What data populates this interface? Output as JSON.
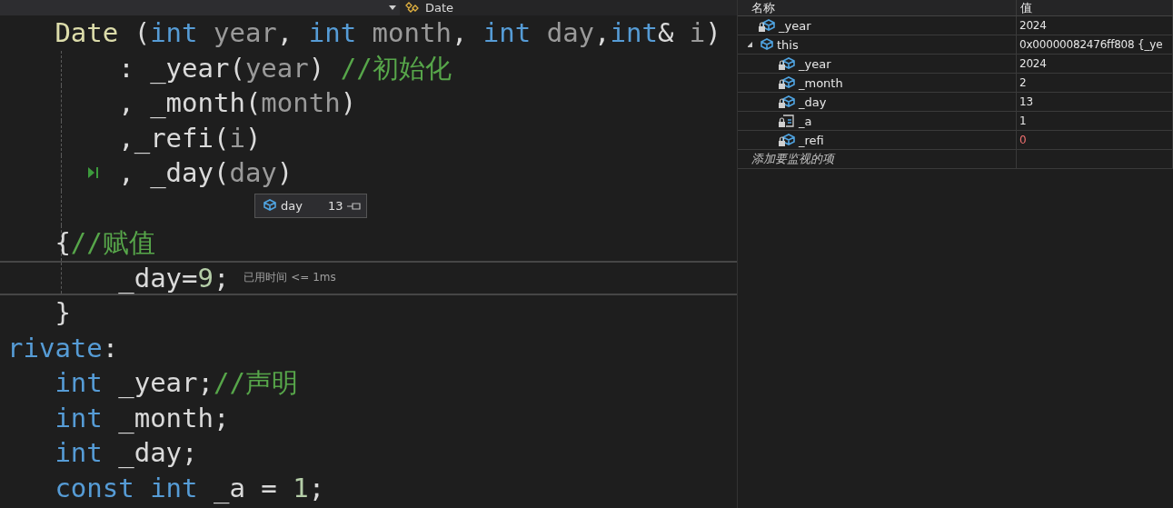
{
  "editor": {
    "nav": {
      "member": "Date"
    },
    "lines": [
      {
        "current": false,
        "tokens": [
          {
            "text": "   Date",
            "kind": "function"
          },
          {
            "text": " (",
            "kind": "plain"
          },
          {
            "text": "int",
            "kind": "keyword"
          },
          {
            "text": " year",
            "kind": "param"
          },
          {
            "text": ", ",
            "kind": "plain"
          },
          {
            "text": "int",
            "kind": "keyword"
          },
          {
            "text": " month",
            "kind": "param"
          },
          {
            "text": ", ",
            "kind": "plain"
          },
          {
            "text": "int",
            "kind": "keyword"
          },
          {
            "text": " day",
            "kind": "param"
          },
          {
            "text": ",",
            "kind": "plain"
          },
          {
            "text": "int",
            "kind": "keyword"
          },
          {
            "text": "& ",
            "kind": "plain"
          },
          {
            "text": "i",
            "kind": "param"
          },
          {
            "text": ")",
            "kind": "plain"
          }
        ]
      },
      {
        "current": false,
        "tokens": [
          {
            "text": "       : _year(",
            "kind": "plain"
          },
          {
            "text": "year",
            "kind": "param"
          },
          {
            "text": ") ",
            "kind": "plain"
          },
          {
            "text": "//初始化",
            "kind": "comment"
          }
        ]
      },
      {
        "current": false,
        "tokens": [
          {
            "text": "       , _month(",
            "kind": "plain"
          },
          {
            "text": "month",
            "kind": "param"
          },
          {
            "text": ")",
            "kind": "plain"
          }
        ]
      },
      {
        "current": false,
        "tokens": [
          {
            "text": "       ,_refi(",
            "kind": "plain"
          },
          {
            "text": "i",
            "kind": "param"
          },
          {
            "text": ")",
            "kind": "plain"
          }
        ]
      },
      {
        "current": false,
        "step_marker": true,
        "tokens": [
          {
            "text": "       , _day(",
            "kind": "plain"
          },
          {
            "text": "day",
            "kind": "param"
          },
          {
            "text": ")",
            "kind": "plain"
          }
        ]
      },
      {
        "datatip": {
          "name": "day",
          "value": "13"
        }
      },
      {
        "current": false,
        "tokens": [
          {
            "text": "   {",
            "kind": "plain"
          },
          {
            "text": "//赋值",
            "kind": "comment"
          }
        ]
      },
      {
        "current": true,
        "tokens": [
          {
            "text": "       _day=",
            "kind": "plain"
          },
          {
            "text": "9",
            "kind": "number"
          },
          {
            "text": ";",
            "kind": "plain"
          }
        ],
        "hint": "已用时间 <= 1ms"
      },
      {
        "current": false,
        "tokens": [
          {
            "text": "   }",
            "kind": "plain"
          }
        ]
      },
      {
        "current": false,
        "tokens": [
          {
            "text": "rivate",
            "kind": "keyword"
          },
          {
            "text": ":",
            "kind": "plain"
          }
        ]
      },
      {
        "current": false,
        "tokens": [
          {
            "text": "   int",
            "kind": "keyword"
          },
          {
            "text": " _year;",
            "kind": "plain"
          },
          {
            "text": "//声明",
            "kind": "comment"
          }
        ]
      },
      {
        "current": false,
        "tokens": [
          {
            "text": "   int",
            "kind": "keyword"
          },
          {
            "text": " _month;",
            "kind": "plain"
          }
        ]
      },
      {
        "current": false,
        "tokens": [
          {
            "text": "   int",
            "kind": "keyword"
          },
          {
            "text": " _day;",
            "kind": "plain"
          }
        ]
      },
      {
        "current": false,
        "tokens": [
          {
            "text": "   const",
            "kind": "keyword"
          },
          {
            "text": " int",
            "kind": "keyword"
          },
          {
            "text": " _a = ",
            "kind": "plain"
          },
          {
            "text": "1",
            "kind": "number"
          },
          {
            "text": ";",
            "kind": "plain"
          }
        ]
      }
    ]
  },
  "watch": {
    "columns": [
      "名称",
      "值"
    ],
    "rows": [
      {
        "name": "_year",
        "value": "2024",
        "kind": "field",
        "changed": false
      },
      {
        "name": "this",
        "value": "0x00000082476ff808 {_ye",
        "kind": "object",
        "changed": false,
        "expanded": true,
        "children": [
          {
            "name": "_year",
            "value": "2024",
            "kind": "field",
            "changed": false
          },
          {
            "name": "_month",
            "value": "2",
            "kind": "field",
            "changed": false
          },
          {
            "name": "_day",
            "value": "13",
            "kind": "field",
            "changed": false
          },
          {
            "name": "_a",
            "value": "1",
            "kind": "const",
            "changed": false
          },
          {
            "name": "_refi",
            "value": "0",
            "kind": "field",
            "changed": true
          }
        ]
      }
    ],
    "add_placeholder": "添加要监视的项"
  }
}
